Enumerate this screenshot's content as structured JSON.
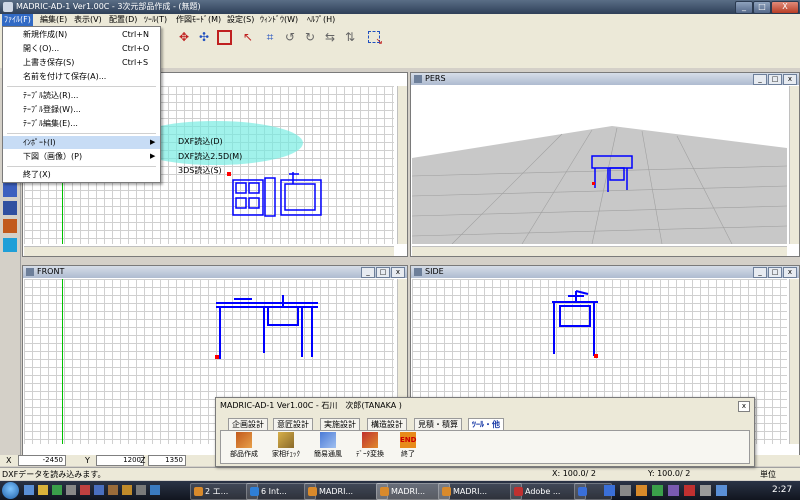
{
  "window": {
    "title": "MADRIC-AD-1 Ver1.00C - 3次元部品作成 - (無題)",
    "min": "_",
    "max": "□",
    "close": "X"
  },
  "menubar": [
    "ﾌｧｲﾙ(F)",
    "編集(E)",
    "表示(V)",
    "配置(D)",
    "ﾂｰﾙ(T)",
    "作図ﾓｰﾄﾞ(M)",
    "設定(S)",
    "ｳｨﾝﾄﾞｳ(W)",
    "ﾍﾙﾌﾟ(H)"
  ],
  "file_menu": {
    "items": [
      {
        "label": "新規作成(N)",
        "shortcut": "Ctrl+N"
      },
      {
        "label": "開く(O)...",
        "shortcut": "Ctrl+O"
      },
      {
        "label": "上書き保存(S)",
        "shortcut": "Ctrl+S"
      },
      {
        "label": "名前を付けて保存(A)...",
        "shortcut": ""
      },
      {
        "label": "ﾃｰﾌﾞﾙ読込(R)...",
        "shortcut": ""
      },
      {
        "label": "ﾃｰﾌﾞﾙ登録(W)...",
        "shortcut": ""
      },
      {
        "label": "ﾃｰﾌﾞﾙ編集(E)...",
        "shortcut": ""
      },
      {
        "label": "ｲﾝﾎﾟｰﾄ(I)",
        "shortcut": ""
      },
      {
        "label": "下図（画像）(P)",
        "shortcut": ""
      },
      {
        "label": "終了(X)",
        "shortcut": ""
      }
    ],
    "arrow": "▶"
  },
  "import_submenu": [
    "DXF読込(D)",
    "DXF読込2.5D(M)",
    "3DS読込(S)"
  ],
  "viewports": {
    "pers": "PERS",
    "front": "FRONT",
    "side": "SIDE"
  },
  "coords": {
    "x_label": "X",
    "x": "-2450",
    "y_label": "Y",
    "y": "1200",
    "z_label": "Z",
    "z": "1350"
  },
  "status": {
    "message": "DXFデータを読み込みます。",
    "grid_x": "X: 100.0/ 2",
    "grid_y": "Y: 100.0/ 2",
    "unit": "単位"
  },
  "palette": {
    "title": "MADRIC-AD-1 Ver1.00C - 石川　次郎(TANAKA )",
    "close": "x",
    "tabs": [
      "企画設計",
      "意匠設計",
      "実施設計",
      "構造設計",
      "見積・積算",
      "ﾂｰﾙ・他"
    ],
    "tools": [
      "部品作成",
      "家相ﾁｪｯｸ",
      "簡易通風",
      "ﾃﾞｰﾀ変換",
      "終了"
    ]
  },
  "taskbar": {
    "items": [
      "2 エ...",
      "6 Int...",
      "MADRI...",
      "MADRI...",
      "MADRI...",
      "Adobe ...",
      ""
    ],
    "clock": "2:27"
  },
  "colors": {
    "accent": "#316ac5",
    "drawing": "#0000ff",
    "highlight": "#6eebe1",
    "grid_green": "#00c000"
  }
}
